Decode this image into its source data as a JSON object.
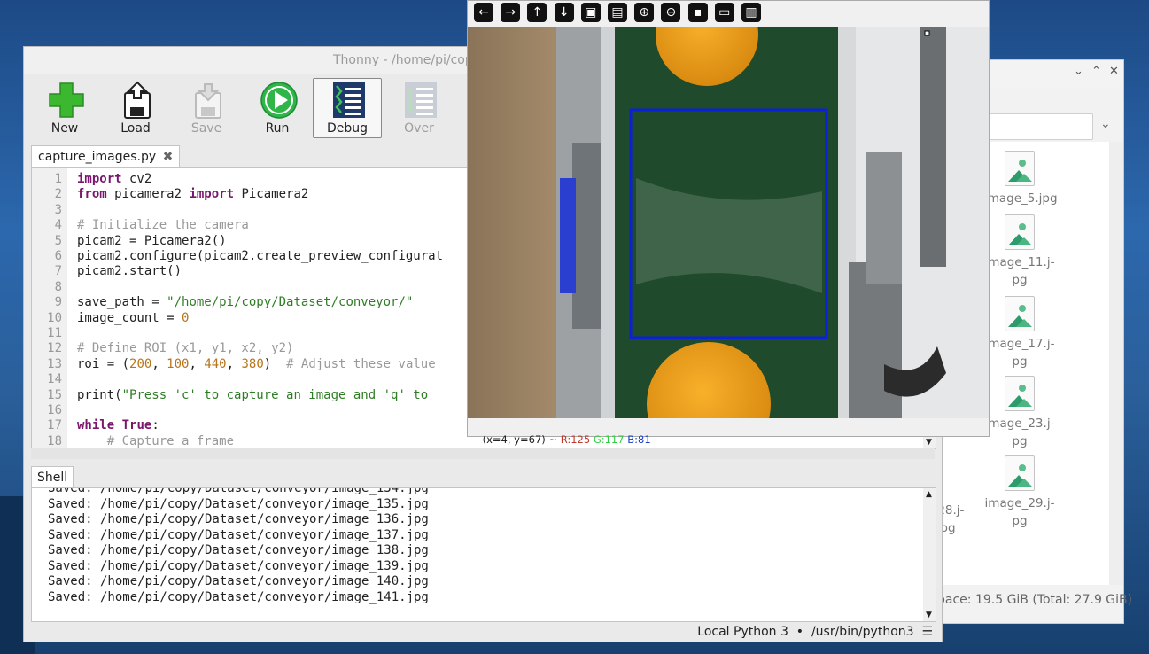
{
  "file_manager": {
    "controls": [
      "⌄",
      "⌃",
      "✕"
    ],
    "files": [
      {
        "name": "image_5.jpg"
      },
      {
        "name": "image_11.j-\npg"
      },
      {
        "name": "image_17.j-\npg"
      },
      {
        "name": "image_23.j-\npg"
      },
      {
        "name": "image_29.j-\npg"
      }
    ],
    "partial_files": [
      "_28.j-\npg",
      "pg"
    ],
    "status": "pace: 19.5 GiB (Total: 27.9 GiB)"
  },
  "thonny": {
    "title": "Thonny  -  /home/pi/cop",
    "toolbar": [
      {
        "label": "New",
        "icon": "new-icon"
      },
      {
        "label": "Load",
        "icon": "load-icon"
      },
      {
        "label": "Save",
        "icon": "save-icon"
      },
      {
        "label": "Run",
        "icon": "run-icon"
      },
      {
        "label": "Debug",
        "icon": "debug-icon"
      },
      {
        "label": "Over",
        "icon": "step-over-icon"
      }
    ],
    "editor_tab": "capture_images.py",
    "code_lines": [
      [
        "kw:import",
        "t: cv2"
      ],
      [
        "kw:from",
        "t: picamera2 ",
        "kw:import",
        "t: Picamera2"
      ],
      [],
      [
        "cm:# Initialize the camera"
      ],
      [
        "t:picam2 = Picamera2()"
      ],
      [
        "t:picam2.configure(picam2.create_preview_configurat"
      ],
      [
        "t:picam2.start()"
      ],
      [],
      [
        "t:save_path = ",
        "st:\"/home/pi/copy/Dataset/conveyor/\""
      ],
      [
        "t:image_count = ",
        "nm:0"
      ],
      [],
      [
        "cm:# Define ROI (x1, y1, x2, y2)"
      ],
      [
        "t:roi = (",
        "nm:200",
        "t:, ",
        "nm:100",
        "t:, ",
        "nm:440",
        "t:, ",
        "nm:380",
        "t:)  ",
        "cm:# Adjust these value"
      ],
      [],
      [
        "t:print(",
        "st:\"Press 'c' to capture an image and 'q' to",
        "t:"
      ],
      [],
      [
        "kw:while",
        "t: ",
        "kw:True",
        "t::"
      ],
      [
        "cm:    # Capture a frame"
      ]
    ],
    "shell_tab": "Shell",
    "shell_lines": [
      "Saved: /home/pi/copy/Dataset/conveyor/image_134.jpg",
      "Saved: /home/pi/copy/Dataset/conveyor/image_135.jpg",
      "Saved: /home/pi/copy/Dataset/conveyor/image_136.jpg",
      "Saved: /home/pi/copy/Dataset/conveyor/image_137.jpg",
      "Saved: /home/pi/copy/Dataset/conveyor/image_138.jpg",
      "Saved: /home/pi/copy/Dataset/conveyor/image_139.jpg",
      "Saved: /home/pi/copy/Dataset/conveyor/image_140.jpg",
      "Saved: /home/pi/copy/Dataset/conveyor/image_141.jpg"
    ],
    "status_bar": "Local Python 3  •  /usr/bin/python3  ☰"
  },
  "opencv_window": {
    "toolbar_icons": [
      "arrow-left-icon",
      "arrow-right-icon",
      "arrow-up-icon",
      "arrow-down-icon",
      "image-icon",
      "image-settings-icon",
      "zoom-in-icon",
      "zoom-out-icon",
      "save-icon",
      "copy-icon",
      "properties-icon"
    ],
    "toolbar_glyphs": [
      "←",
      "→",
      "↑",
      "↓",
      "▣",
      "▤",
      "⊕",
      "⊖",
      "▪",
      "▭",
      "▥"
    ],
    "status_prefix": "(x=4, y=67) ~ ",
    "status_r": "R:125",
    "status_g": "G:117",
    "status_b": "B:81",
    "status_colors": {
      "r": "#c0392b",
      "g": "#2ecc40",
      "b": "#1a3fbf"
    }
  }
}
